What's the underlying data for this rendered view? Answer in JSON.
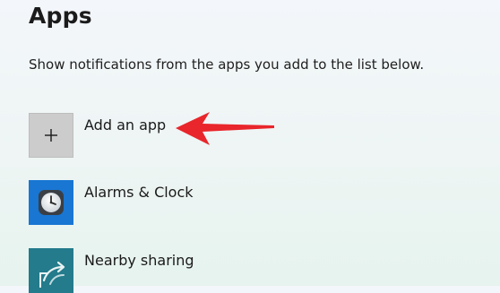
{
  "section": {
    "title": "Apps",
    "description": "Show notifications from the apps you add to the list below."
  },
  "apps": [
    {
      "label": "Add an app",
      "icon": "plus-icon"
    },
    {
      "label": "Alarms & Clock",
      "icon": "clock-icon"
    },
    {
      "label": "Nearby sharing",
      "icon": "share-icon"
    }
  ],
  "colors": {
    "add_tile": "#cccccc",
    "alarms_tile": "#1976d2",
    "nearby_tile": "#237b8b",
    "annotation_arrow": "#e8262b"
  }
}
